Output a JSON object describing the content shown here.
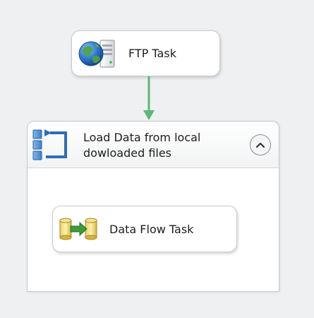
{
  "ftp_task": {
    "label": "FTP Task",
    "icon": "globe-server-icon"
  },
  "container": {
    "title": "Load Data from local dowloaded files",
    "icon": "foreach-loop-icon",
    "collapse_icon": "chevron-up-icon"
  },
  "data_flow_task": {
    "label": "Data Flow Task",
    "icon": "data-flow-icon"
  },
  "connector": {
    "color": "#5bb878"
  }
}
